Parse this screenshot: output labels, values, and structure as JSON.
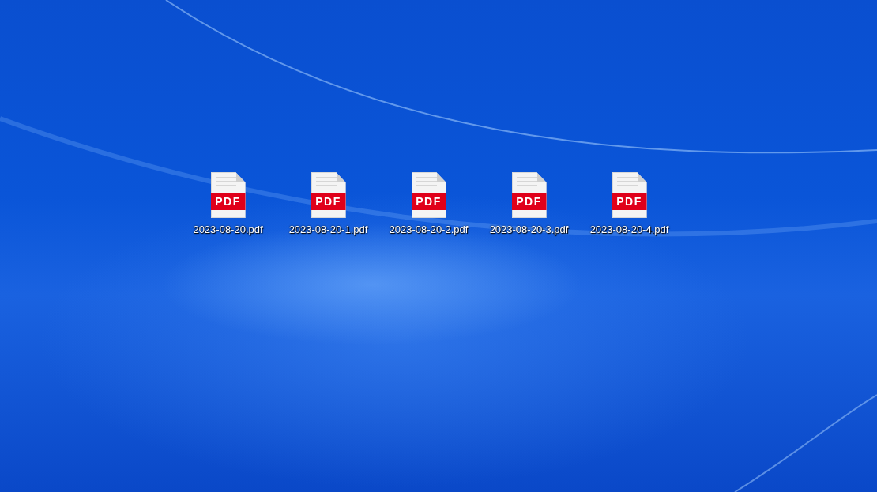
{
  "desktop_icons": [
    {
      "badge": "PDF",
      "label": "2023-08-20.pdf"
    },
    {
      "badge": "PDF",
      "label": "2023-08-20-1.pdf"
    },
    {
      "badge": "PDF",
      "label": "2023-08-20-2.pdf"
    },
    {
      "badge": "PDF",
      "label": "2023-08-20-3.pdf"
    },
    {
      "badge": "PDF",
      "label": "2023-08-20-4.pdf"
    }
  ]
}
